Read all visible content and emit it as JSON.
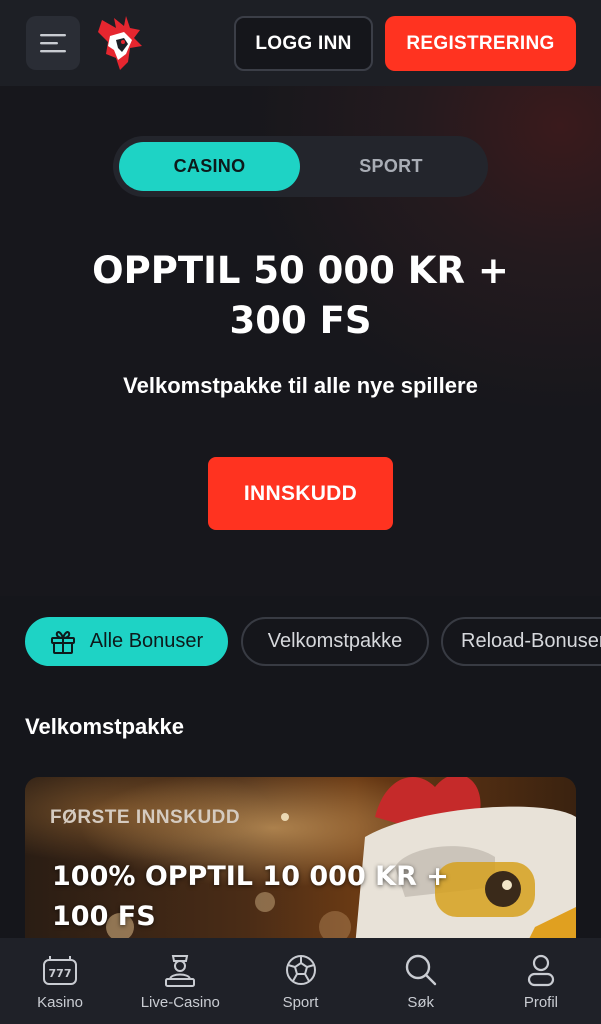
{
  "header": {
    "login_label": "LOGG INN",
    "register_label": "REGISTRERING"
  },
  "hero": {
    "tabs": [
      {
        "label": "CASINO",
        "active": true
      },
      {
        "label": "SPORT",
        "active": false
      }
    ],
    "title_line1": "OPPTIL 50 000 KR +",
    "title_line2": "300 FS",
    "subtitle": "Velkomstpakke til alle nye spillere",
    "deposit_label": "INNSKUDD"
  },
  "filters": [
    {
      "label": "Alle Bonuser",
      "icon": "gift-icon",
      "active": true
    },
    {
      "label": "Velkomstpakke",
      "active": false
    },
    {
      "label": "Reload-Bonuser",
      "active": false
    }
  ],
  "section": {
    "title": "Velkomstpakke"
  },
  "promo_card": {
    "label": "FØRSTE INNSKUDD",
    "title_line1": "100% OPPTIL 10 000 KR +",
    "title_line2": "100 FS"
  },
  "bottom_nav": [
    {
      "label": "Kasino",
      "icon": "slot-777-icon"
    },
    {
      "label": "Live-Casino",
      "icon": "dealer-icon"
    },
    {
      "label": "Sport",
      "icon": "soccer-ball-icon"
    },
    {
      "label": "Søk",
      "icon": "search-icon"
    },
    {
      "label": "Profil",
      "icon": "user-icon"
    }
  ],
  "colors": {
    "accent_teal": "#1ed3c5",
    "accent_red": "#ff3320",
    "background": "#15161b"
  }
}
